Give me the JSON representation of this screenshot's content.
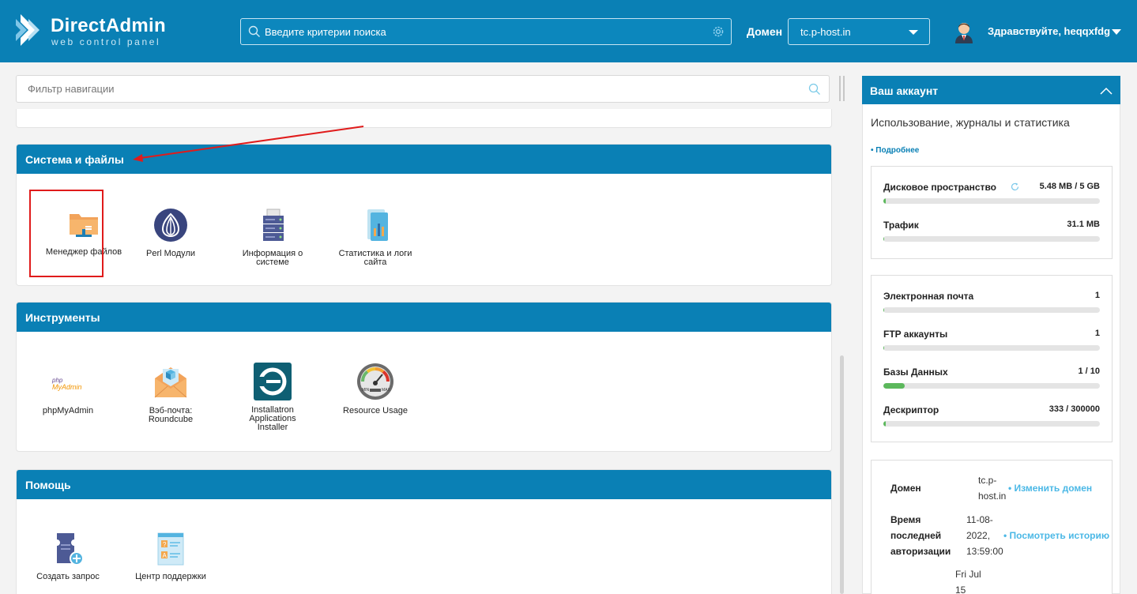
{
  "header": {
    "brand_title": "DirectAdmin",
    "brand_subtitle": "web control panel",
    "search_placeholder": "Введите критерии поиска",
    "domain_label": "Домен",
    "domain_value": "tc.p-host.in",
    "greeting": "Здравствуйте, heqqxfdg",
    "icons": [
      "directadmin-logo",
      "search-icon",
      "gear-icon",
      "chevron-down-icon",
      "avatar",
      "chevron-down-icon"
    ]
  },
  "nav_filter": {
    "placeholder": "Фильтр навигации"
  },
  "sections": [
    {
      "title": "Система и файлы",
      "items": [
        {
          "label": "Менеджер файлов",
          "icon": "folder-icon"
        },
        {
          "label": "Perl Модули",
          "icon": "perl-onion-icon"
        },
        {
          "label": "Информация о системе",
          "icon": "server-icon"
        },
        {
          "label": "Статистика и логи сайта",
          "icon": "stats-icon"
        }
      ]
    },
    {
      "title": "Инструменты",
      "items": [
        {
          "label": "phpMyAdmin",
          "icon": "phpmyadmin-icon"
        },
        {
          "label": "Вэб-почта: Roundcube",
          "icon": "envelope-icon"
        },
        {
          "label": "Installatron Applications Installer",
          "icon": "installatron-icon"
        },
        {
          "label": "Resource Usage",
          "icon": "gauge-icon"
        }
      ]
    },
    {
      "title": "Помощь",
      "items": [
        {
          "label": "Создать запрос",
          "icon": "ticket-add-icon"
        },
        {
          "label": "Центр поддержки",
          "icon": "support-center-icon"
        }
      ]
    }
  ],
  "account": {
    "title": "Ваш аккаунт",
    "description": "Использование, журналы и статистика",
    "more_link": "• Подробнее",
    "usage": [
      {
        "label": "Дисковое пространство",
        "value": "5.48 MB / 5 GB",
        "fraction": 0.001
      },
      {
        "label": "Трафик",
        "value": "31.1 MB",
        "fraction": 0
      }
    ],
    "counts": [
      {
        "label": "Электронная почта",
        "value": "1",
        "fraction": 0
      },
      {
        "label": "FTP аккаунты",
        "value": "1",
        "fraction": 0
      },
      {
        "label": "Базы Данных",
        "value": "1 / 10",
        "fraction": 0.1
      },
      {
        "label": "Дескриптор",
        "value": "333 / 300000",
        "fraction": 0.001
      }
    ],
    "info": {
      "domain_label": "Домен",
      "domain_value": "tc.p-host.in",
      "change_domain_link": "• Изменить домен",
      "last_login_label": "Время последней авторизации",
      "last_login_value": "11-08-2022, 13:59:00",
      "history_link": "• Посмотреть историю",
      "created_value": "Fri Jul 15"
    },
    "colors": {
      "header": "#0a80b5",
      "bar_fill": "#5cb85c",
      "link": "#4bb8e6"
    }
  }
}
